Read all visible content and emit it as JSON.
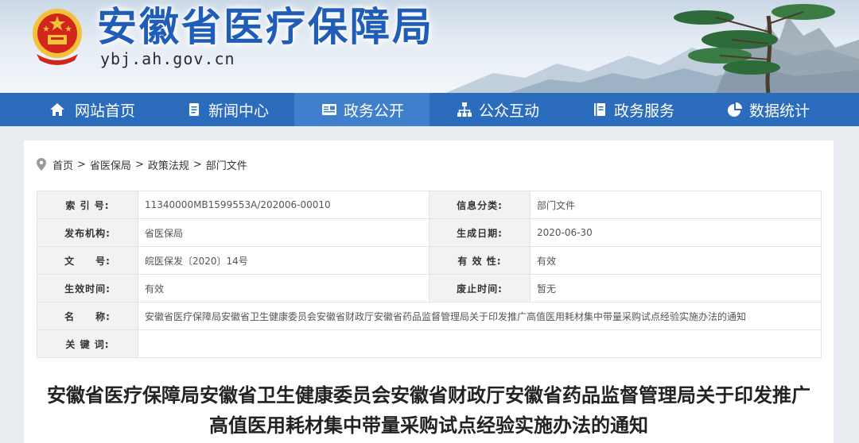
{
  "site": {
    "title": "安徽省医疗保障局",
    "url": "ybj.ah.gov.cn"
  },
  "nav": {
    "items": [
      {
        "label": "网站首页",
        "icon": "home-icon"
      },
      {
        "label": "新闻中心",
        "icon": "document-icon"
      },
      {
        "label": "政务公开",
        "icon": "id-card-icon"
      },
      {
        "label": "公众互动",
        "icon": "network-icon"
      },
      {
        "label": "政务服务",
        "icon": "book-icon"
      },
      {
        "label": "数据统计",
        "icon": "pie-chart-icon"
      }
    ],
    "active_index": 2
  },
  "breadcrumb": [
    "首页",
    "省医保局",
    "政策法规",
    "部门文件"
  ],
  "breadcrumb_separator": ">",
  "info": {
    "index_no_label": "索 引 号:",
    "index_no": "11340000MB1599553A/202006-00010",
    "category_label": "信息分类:",
    "category": "部门文件",
    "publisher_label": "发布机构:",
    "publisher": "省医保局",
    "date_label": "生成日期:",
    "date": "2020-06-30",
    "doc_no_label": "文　　号:",
    "doc_no": "皖医保发〔2020〕14号",
    "validity_label": "有 效 性:",
    "validity": "有效",
    "effective_label": "生效时间:",
    "effective": "有效",
    "repeal_label": "废止时间:",
    "repeal": "暂无",
    "name_label": "名　　称:",
    "name": "安徽省医疗保障局安徽省卫生健康委员会安徽省财政厅安徽省药品监督管理局关于印发推广高值医用耗材集中带量采购试点经验实施办法的通知",
    "keywords_label": "关 键 词:",
    "keywords": ""
  },
  "document": {
    "title": "安徽省医疗保障局安徽省卫生健康委员会安徽省财政厅安徽省药品监督管理局关于印发推广高值医用耗材集中带量采购试点经验实施办法的通知"
  },
  "colors": {
    "nav_bg": "#2b6cbc",
    "nav_active": "#3f7fcb",
    "title_blue": "#1f5db8",
    "emblem_red": "#d2251c",
    "emblem_gold": "#f4c23a"
  }
}
